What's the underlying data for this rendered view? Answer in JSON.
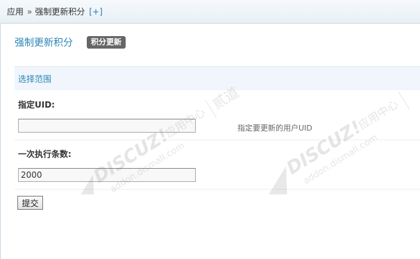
{
  "breadcrumb": {
    "root": "应用",
    "separator": "»",
    "current": "强制更新积分",
    "toggle": "[+]"
  },
  "page": {
    "title": "强制更新积分",
    "badge": "积分更新"
  },
  "section": {
    "title": "选择范围"
  },
  "form": {
    "uid_label": "指定UID:",
    "uid_value": "",
    "uid_hint": "指定要更新的用户UID",
    "batch_label": "一次执行条数:",
    "batch_value": "2000",
    "submit_label": "提交"
  },
  "watermark": {
    "brand": "DISCUZ!",
    "cn": "应用中心",
    "url": "addon.dismall.com",
    "side": "贰道"
  },
  "colors": {
    "accent": "#2b86b8",
    "badge_bg": "#666666",
    "section_bg": "#f0f6fb"
  }
}
